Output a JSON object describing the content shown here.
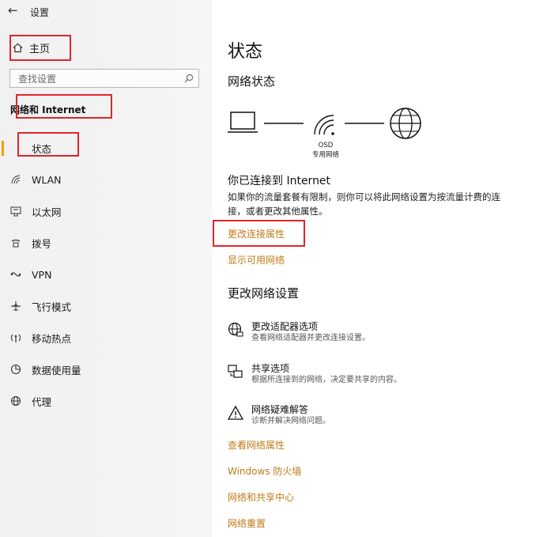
{
  "window": {
    "title": "设置",
    "back_glyph": "←"
  },
  "sidebar": {
    "home_label": "主页",
    "search_placeholder": "查找设置",
    "section_title": "网络和 Internet",
    "items": [
      {
        "label": "状态",
        "icon": "status-icon",
        "selected": true
      },
      {
        "label": "WLAN",
        "icon": "wifi-icon",
        "selected": false
      },
      {
        "label": "以太网",
        "icon": "ethernet-icon",
        "selected": false
      },
      {
        "label": "拨号",
        "icon": "dialup-icon",
        "selected": false
      },
      {
        "label": "VPN",
        "icon": "vpn-icon",
        "selected": false
      },
      {
        "label": "飞行模式",
        "icon": "airplane-icon",
        "selected": false
      },
      {
        "label": "移动热点",
        "icon": "hotspot-icon",
        "selected": false
      },
      {
        "label": "数据使用量",
        "icon": "data-usage-icon",
        "selected": false
      },
      {
        "label": "代理",
        "icon": "proxy-icon",
        "selected": false
      }
    ]
  },
  "main": {
    "title": "状态",
    "network_status_heading": "网络状态",
    "network_name": "OSD",
    "network_type": "专用网络",
    "connected_text": "你已连接到 Internet",
    "description": "如果你的流量套餐有限制，则你可以将此网络设置为按流量计费的连接，或者更改其他属性。",
    "change_connection_properties": "更改连接属性",
    "show_available_networks": "显示可用网络",
    "change_network_settings_heading": "更改网络设置",
    "options": [
      {
        "title": "更改适配器选项",
        "subtitle": "查看网络适配器并更改连接设置。",
        "icon": "adapter-globe-icon"
      },
      {
        "title": "共享选项",
        "subtitle": "根据所连接到的网络，决定要共享的内容。",
        "icon": "sharing-icon"
      },
      {
        "title": "网络疑难解答",
        "subtitle": "诊断并解决网络问题。",
        "icon": "warning-icon"
      }
    ],
    "links": [
      "查看网络属性",
      "Windows 防火墙",
      "网络和共享中心",
      "网络重置"
    ]
  },
  "colors": {
    "accent": "#f0a000",
    "link": "#c07b1b",
    "highlight": "#e0252a"
  }
}
